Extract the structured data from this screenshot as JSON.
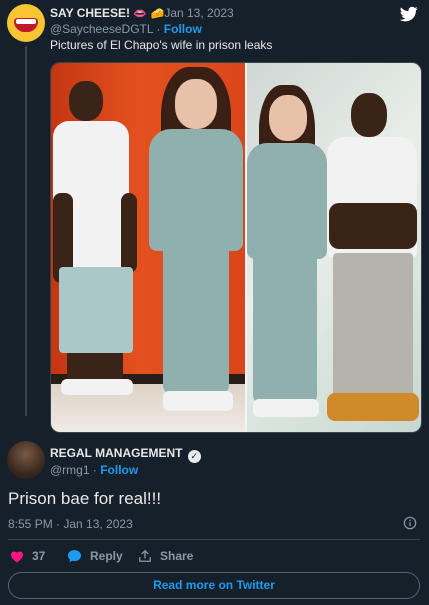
{
  "quoted": {
    "name": "SAY CHEESE!",
    "emoji_lips": "👄",
    "emoji_cheese": "🧀",
    "date": "· Jan 13, 2023",
    "handle": "@SaycheeseDGTL",
    "separator": " · ",
    "follow": "Follow",
    "text": "Pictures of El Chapo's wife in prison leaks"
  },
  "reply": {
    "name": "REGAL MANAGEMENT",
    "verified": "✓",
    "handle": "@rmg1",
    "separator": " · ",
    "follow": "Follow",
    "text": "Prison bae for real!!!",
    "timestamp": "8:55 PM · Jan 13, 2023"
  },
  "actions": {
    "like_count": "37",
    "reply_label": "Reply",
    "share_label": "Share"
  },
  "footer": {
    "read_more": "Read more on Twitter"
  },
  "colors": {
    "background": "#15202b",
    "accent": "#1d9bf0",
    "like": "#f91880",
    "muted": "#8b98a5"
  },
  "icons": [
    "twitter-bird-icon",
    "verified-badge-icon",
    "info-icon",
    "heart-icon",
    "reply-bubble-icon",
    "share-icon"
  ]
}
